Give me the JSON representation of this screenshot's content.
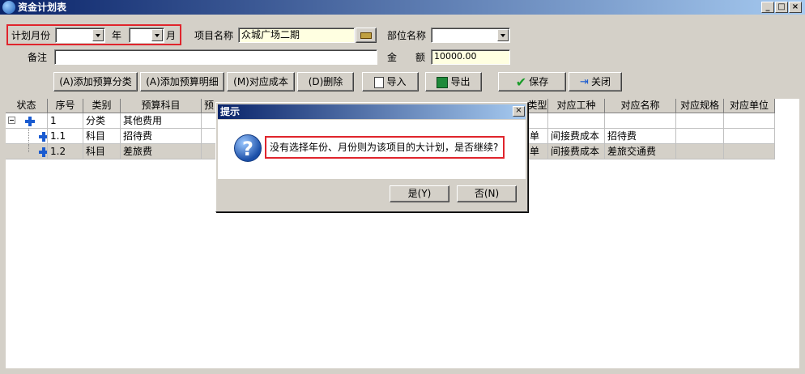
{
  "window": {
    "title": "资金计划表"
  },
  "form": {
    "plan_month_label": "计划月份",
    "year_label": "年",
    "month_label": "月",
    "year_value": "",
    "month_value": "",
    "project_name_label": "项目名称",
    "project_name_value": "众城广场二期",
    "dept_name_label": "部位名称",
    "dept_name_value": "",
    "remark_label": "备注",
    "remark_value": "",
    "amount_label_1": "金",
    "amount_label_2": "额",
    "amount_value": "10000.00"
  },
  "toolbar": {
    "add_category": "(A)添加预算分类",
    "add_detail": "(A)添加预算明细",
    "match_cost": "(M)对应成本",
    "delete": "(D)删除",
    "import": "导入",
    "export": "导出",
    "save": "保存",
    "close": "关闭"
  },
  "grid": {
    "columns": [
      "状态",
      "序号",
      "类别",
      "预算科目",
      "预",
      "类型",
      "对应工种",
      "对应名称",
      "对应规格",
      "对应单位"
    ],
    "rows": [
      {
        "seq": "1",
        "category": "分类",
        "subject": "其他费用",
        "type": "",
        "work": "",
        "name": "",
        "spec": "",
        "unit": ""
      },
      {
        "seq": "1.1",
        "category": "科目",
        "subject": "招待费",
        "type": "单",
        "work": "间接费成本",
        "name": "招待费",
        "spec": "",
        "unit": ""
      },
      {
        "seq": "1.2",
        "category": "科目",
        "subject": "差旅费",
        "type": "单",
        "work": "间接费成本",
        "name": "差旅交通费",
        "spec": "",
        "unit": ""
      }
    ]
  },
  "dialog": {
    "title": "提示",
    "message": "没有选择年份、月份则为该项目的大计划，是否继续?",
    "yes": "是(Y)",
    "no": "否(N)"
  },
  "colors": {
    "highlight": "#e0242c",
    "title_start": "#0a246a",
    "title_end": "#a6caf0"
  }
}
